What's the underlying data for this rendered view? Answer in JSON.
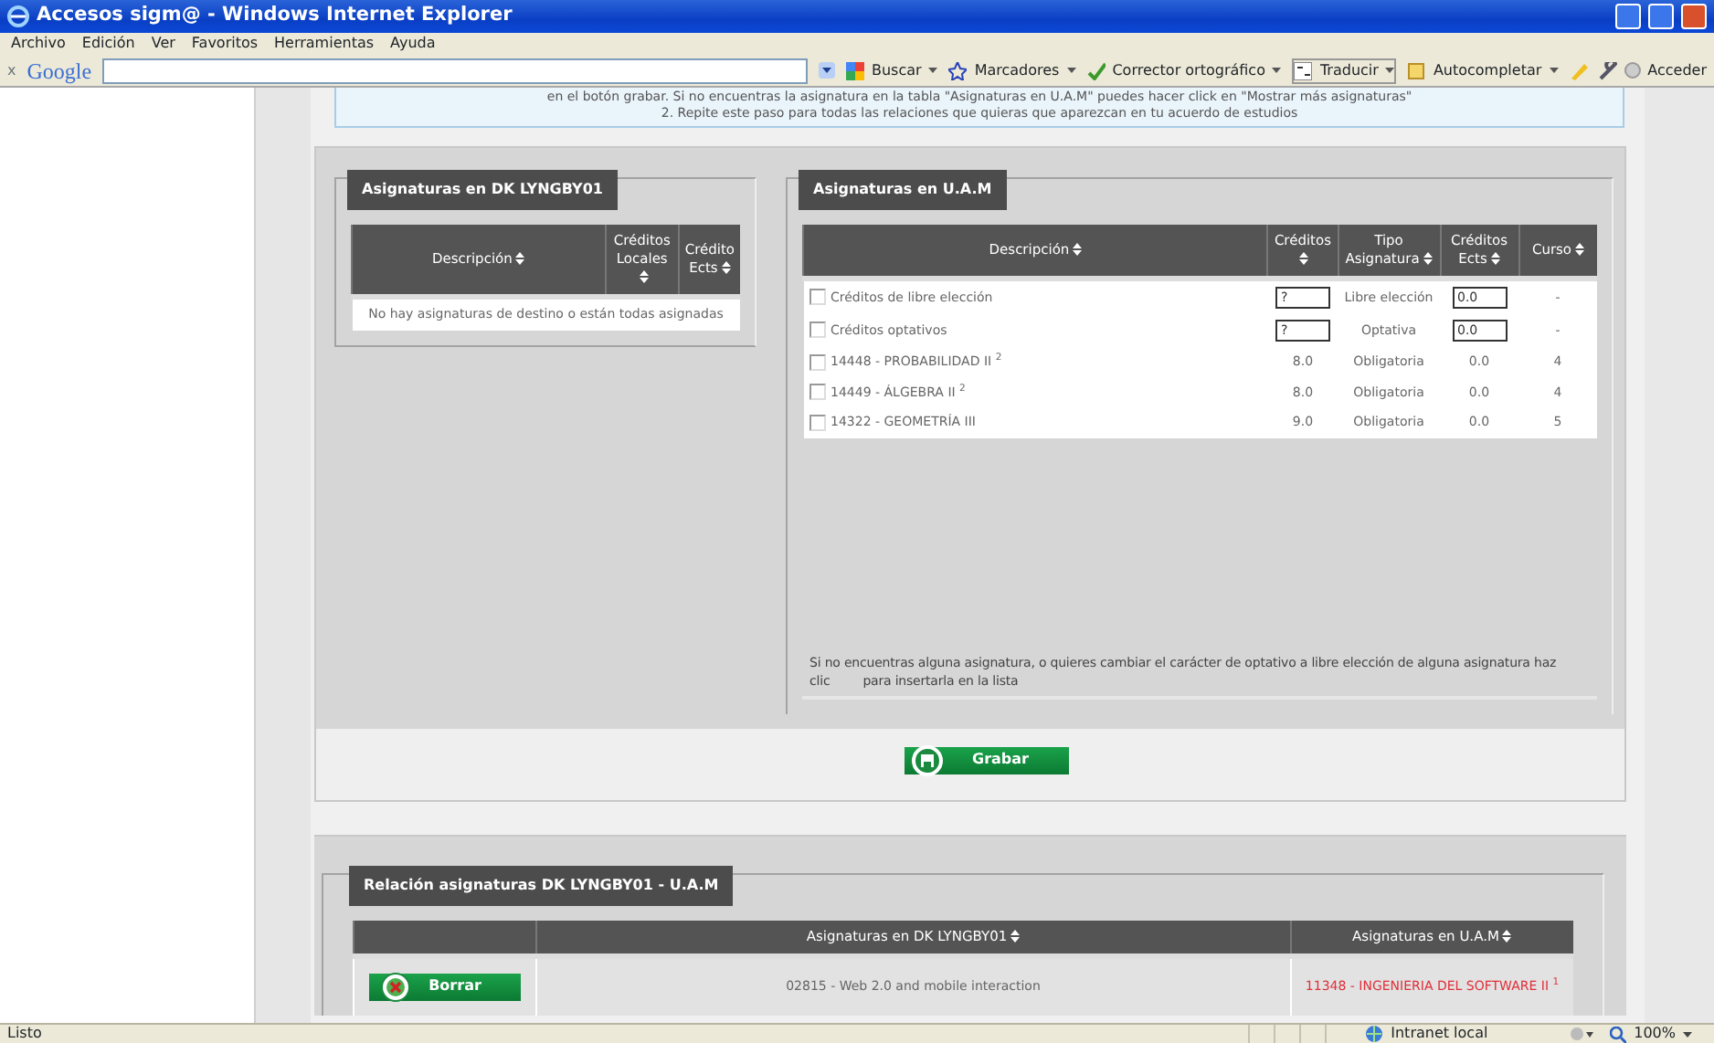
{
  "window": {
    "title": "Accesos sigm@ - Windows Internet Explorer"
  },
  "menu": [
    "Archivo",
    "Edición",
    "Ver",
    "Favoritos",
    "Herramientas",
    "Ayuda"
  ],
  "toolbar": {
    "close": "x",
    "brand": "Google",
    "items": [
      {
        "kind": "dropdown",
        "label": "Buscar"
      },
      {
        "kind": "dropdown",
        "label": "Marcadores"
      },
      {
        "kind": "dropdown",
        "label": "Corrector ortográfico"
      },
      {
        "kind": "split",
        "label": "Traducir"
      },
      {
        "kind": "dropdown",
        "label": "Autocompletar"
      }
    ],
    "signin": "Acceder"
  },
  "instructions": [
    "en el botón grabar. Si no encuentras la asignatura en la tabla \"Asignaturas en U.A.M\" puedes hacer click en \"Mostrar más asignaturas\"",
    "2. Repite este paso para todas las relaciones que quieras que aparezcan en tu acuerdo de estudios"
  ],
  "origin_panel": {
    "title": "Asignaturas en DK LYNGBY01",
    "columns": [
      "Descripción",
      "Créditos Locales",
      "Crédito Ects"
    ],
    "empty_message": "No hay asignaturas de destino o están todas asignadas"
  },
  "target_panel": {
    "title": "Asignaturas en U.A.M",
    "columns": [
      "Descripción",
      "Créditos",
      "Tipo Asignatura",
      "Créditos Ects",
      "Curso"
    ],
    "rows": [
      {
        "kind": "input",
        "checked": false,
        "description": "Créditos de libre elección",
        "credits": "?",
        "type": "Libre elección",
        "ects": "0.0",
        "course": "-"
      },
      {
        "kind": "input",
        "checked": false,
        "description": "Créditos optativos",
        "credits": "?",
        "type": "Optativa",
        "ects": "0.0",
        "course": "-"
      },
      {
        "kind": "text",
        "checked": false,
        "description": "14448 - PROBABILIDAD II $^{2}$",
        "credits": "8.0",
        "type": "Obligatoria",
        "ects": "0.0",
        "course": "4"
      },
      {
        "kind": "text",
        "checked": false,
        "description": "14449 - ÁLGEBRA II $^{2}$",
        "credits": "8.0",
        "type": "Obligatoria",
        "ects": "0.0",
        "course": "4"
      },
      {
        "kind": "text",
        "checked": false,
        "description": "14322 - GEOMETRÍA III",
        "credits": "9.0",
        "type": "Obligatoria",
        "ects": "0.0",
        "course": "5"
      }
    ],
    "note": [
      "Si no encuentras alguna asignatura, o quieres cambiar el carácter de optativo a libre elección de alguna asignatura haz",
      "clic",
      "para insertarla en la lista"
    ]
  },
  "save_button": "Grabar",
  "relation_panel": {
    "title": "Relación asignaturas DK LYNGBY01 - U.A.M",
    "columns": [
      "Asignaturas en DK LYNGBY01",
      "Asignaturas en U.A.M"
    ],
    "rows": [
      {
        "button": "Borrar",
        "origin": "02815 - Web 2.0 and mobile interaction",
        "target": "11348 - INGENIERIA DEL SOFTWARE II $^{1}$"
      }
    ]
  },
  "status_bar": {
    "text": "Listo",
    "zone": "Intranet local",
    "zoom": "100%"
  }
}
